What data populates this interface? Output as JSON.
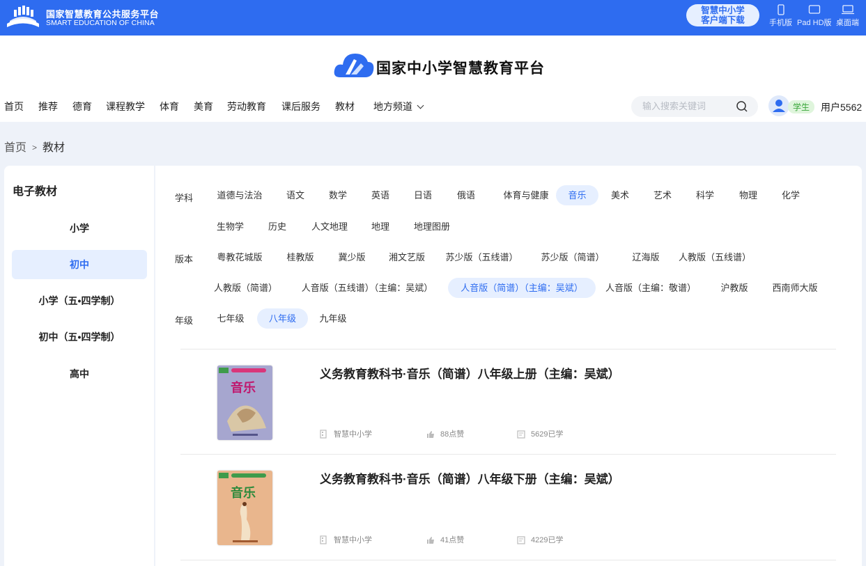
{
  "topbar": {
    "title_cn": "国家智慧教育公共服务平台",
    "title_en": "SMART EDUCATION OF CHINA",
    "download_line1": "智慧中小学",
    "download_line2": "客户端下载",
    "devices": [
      {
        "label": "手机版",
        "icon": "phone-icon"
      },
      {
        "label": "Pad HD版",
        "icon": "tablet-icon"
      },
      {
        "label": "桌面端",
        "icon": "laptop-icon"
      }
    ]
  },
  "header": {
    "brand_name": "国家中小学智慧教育平台",
    "nav": [
      "首页",
      "推荐",
      "德育",
      "课程教学",
      "体育",
      "美育",
      "劳动教育",
      "课后服务",
      "教材",
      "地方频道"
    ],
    "search_placeholder": "输入搜索关键词",
    "role_badge": "学生",
    "username": "用户5562"
  },
  "breadcrumb": {
    "home": "首页",
    "sep": ">",
    "current": "教材"
  },
  "sidebar": {
    "title": "电子教材",
    "items": [
      "小学",
      "初中",
      "小学（五•四学制）",
      "初中（五•四学制）",
      "高中"
    ],
    "active_index": 1
  },
  "filters": {
    "subject_label": "学科",
    "subjects": [
      "道德与法治",
      "语文",
      "数学",
      "英语",
      "日语",
      "俄语",
      "体育与健康",
      "音乐",
      "美术",
      "艺术",
      "科学",
      "物理",
      "化学",
      "生物学",
      "历史",
      "人文地理",
      "地理",
      "地理图册"
    ],
    "subject_active": "音乐",
    "edition_label": "版本",
    "editions": [
      "粤教花城版",
      "桂教版",
      "冀少版",
      "湘文艺版",
      "苏少版（五线谱）",
      "苏少版（简谱）",
      "辽海版",
      "人教版（五线谱）",
      "人教版（简谱）",
      "人音版（五线谱）（主编：吴斌）",
      "人音版（简谱）（主编：吴斌）",
      "人音版（主编：敬谱）",
      "沪教版",
      "西南师大版"
    ],
    "edition_active": "人音版（简谱）（主编：吴斌）",
    "grade_label": "年级",
    "grades": [
      "七年级",
      "八年级",
      "九年级"
    ],
    "grade_active": "八年级"
  },
  "books": [
    {
      "title": "义务教育教科书·音乐（简谱）八年级上册（主编：吴斌）",
      "cover_text": "音乐",
      "source": "智慧中小学",
      "likes": "88点赞",
      "learners": "5629已学"
    },
    {
      "title": "义务教育教科书·音乐（简谱）八年级下册（主编：吴斌）",
      "cover_text": "音乐",
      "source": "智慧中小学",
      "likes": "41点赞",
      "learners": "4229已学"
    }
  ],
  "colors": {
    "primary": "#2e6cf0",
    "active_bg": "#e6efff",
    "page_bg": "#eef2f9"
  }
}
